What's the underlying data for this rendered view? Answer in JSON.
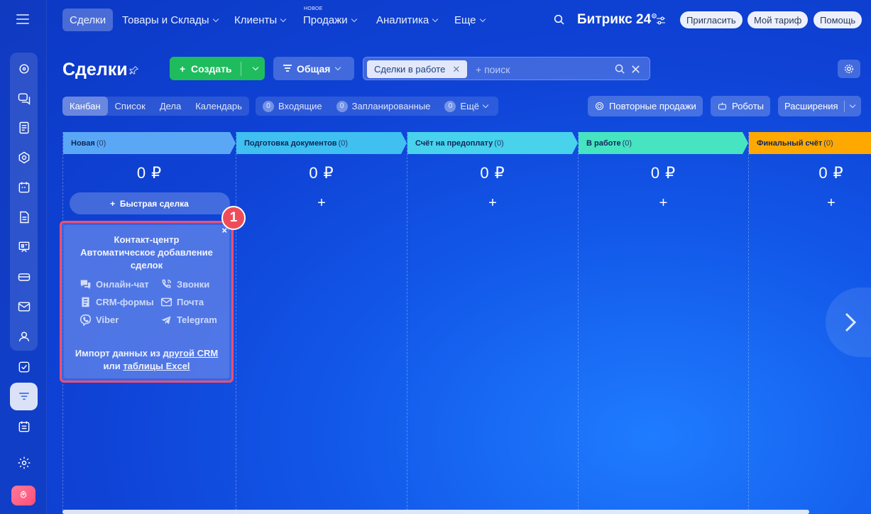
{
  "app": {
    "brand": "Битрикс",
    "brand_num": "24",
    "brand_sup": "⊙"
  },
  "topnav": {
    "items": [
      {
        "label": "Сделки"
      },
      {
        "label": "Товары и Склады"
      },
      {
        "label": "Клиенты"
      },
      {
        "label": "Продажи",
        "badge": "НОВОЕ"
      },
      {
        "label": "Аналитика"
      },
      {
        "label": "Еще"
      }
    ],
    "buttons": [
      "Пригласить",
      "Мой тариф",
      "Помощь"
    ]
  },
  "page": {
    "title": "Сделки"
  },
  "toolbar": {
    "create_label": "Создать",
    "filter_label": "Общая",
    "search_chip": "Сделки в работе",
    "search_placeholder": "+ поиск"
  },
  "view_tabs": [
    "Канбан",
    "Список",
    "Дела",
    "Календарь"
  ],
  "counters": [
    {
      "count": "0",
      "label": "Входящие"
    },
    {
      "count": "0",
      "label": "Запланированные"
    },
    {
      "count": "0",
      "label": "Ещё"
    }
  ],
  "right_buttons": {
    "repeat_sales": "Повторные продажи",
    "robots": "Роботы",
    "extensions": "Расширения"
  },
  "stages": [
    {
      "name": "Новая",
      "count": "(0)",
      "sum": "0 ₽",
      "color": "#5aa8f5"
    },
    {
      "name": "Подготовка документов",
      "count": "(0)",
      "sum": "0 ₽",
      "color": "#3fc0f0"
    },
    {
      "name": "Счёт на предоплату",
      "count": "(0)",
      "sum": "0 ₽",
      "color": "#48d2ec"
    },
    {
      "name": "В работе",
      "count": "(0)",
      "sum": "0 ₽",
      "color": "#47e4c1"
    },
    {
      "name": "Финальный счёт",
      "count": "(0)",
      "sum": "0 ₽",
      "color": "#ffa900"
    }
  ],
  "quick_deal_label": "Быстрая сделка",
  "add_symbol": "+",
  "promo": {
    "line1": "Контакт-центр",
    "line2": "Автоматическое добавление",
    "line3": "сделок",
    "sources": [
      "Онлайн-чат",
      "Звонки",
      "CRM-формы",
      "Почта",
      "Viber",
      "Telegram"
    ],
    "import_prefix": "Импорт данных из",
    "import_link1": "другой CRM",
    "import_or": "или",
    "import_link2": "таблицы Excel",
    "close": "×",
    "step_badge": "1"
  }
}
